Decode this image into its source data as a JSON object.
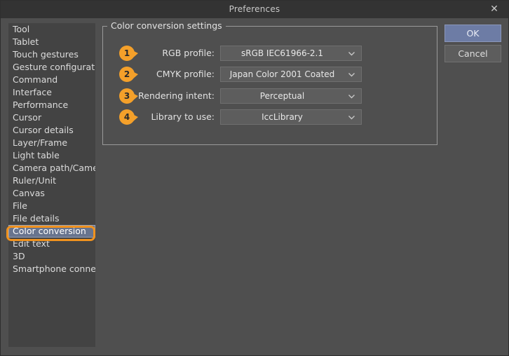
{
  "window": {
    "title": "Preferences",
    "close_icon": "close-icon",
    "accent_orange": "#f4a02a",
    "selection_blue": "#68748e",
    "ok_blue": "#6d7ca5",
    "background": "#4f4f4f",
    "sidebar_background": "#434343"
  },
  "sidebar": {
    "items": [
      {
        "label": "Tool",
        "selected": false
      },
      {
        "label": "Tablet",
        "selected": false
      },
      {
        "label": "Touch gestures",
        "selected": false
      },
      {
        "label": "Gesture configuration",
        "selected": false
      },
      {
        "label": "Command",
        "selected": false
      },
      {
        "label": "Interface",
        "selected": false
      },
      {
        "label": "Performance",
        "selected": false
      },
      {
        "label": "Cursor",
        "selected": false
      },
      {
        "label": "Cursor details",
        "selected": false
      },
      {
        "label": "Layer/Frame",
        "selected": false
      },
      {
        "label": "Light table",
        "selected": false
      },
      {
        "label": "Camera path/Camera",
        "selected": false
      },
      {
        "label": "Ruler/Unit",
        "selected": false
      },
      {
        "label": "Canvas",
        "selected": false
      },
      {
        "label": "File",
        "selected": false
      },
      {
        "label": "File details",
        "selected": false
      },
      {
        "label": "Color conversion",
        "selected": true
      },
      {
        "label": "Edit text",
        "selected": false
      },
      {
        "label": "3D",
        "selected": false
      },
      {
        "label": "Smartphone connection",
        "selected": false
      }
    ]
  },
  "groupbox": {
    "title": "Color conversion settings",
    "rows": [
      {
        "badge": "1",
        "label": "RGB profile:",
        "value": "sRGB IEC61966-2.1",
        "arrow_icon": "chevron-down-icon"
      },
      {
        "badge": "2",
        "label": "CMYK profile:",
        "value": "Japan Color 2001 Coated",
        "arrow_icon": "chevron-down-icon"
      },
      {
        "badge": "3",
        "label": "Rendering intent:",
        "value": "Perceptual",
        "arrow_icon": "chevron-down-icon"
      },
      {
        "badge": "4",
        "label": "Library to use:",
        "value": "IccLibrary",
        "arrow_icon": "chevron-down-icon"
      }
    ]
  },
  "buttons": {
    "ok": "OK",
    "cancel": "Cancel"
  }
}
